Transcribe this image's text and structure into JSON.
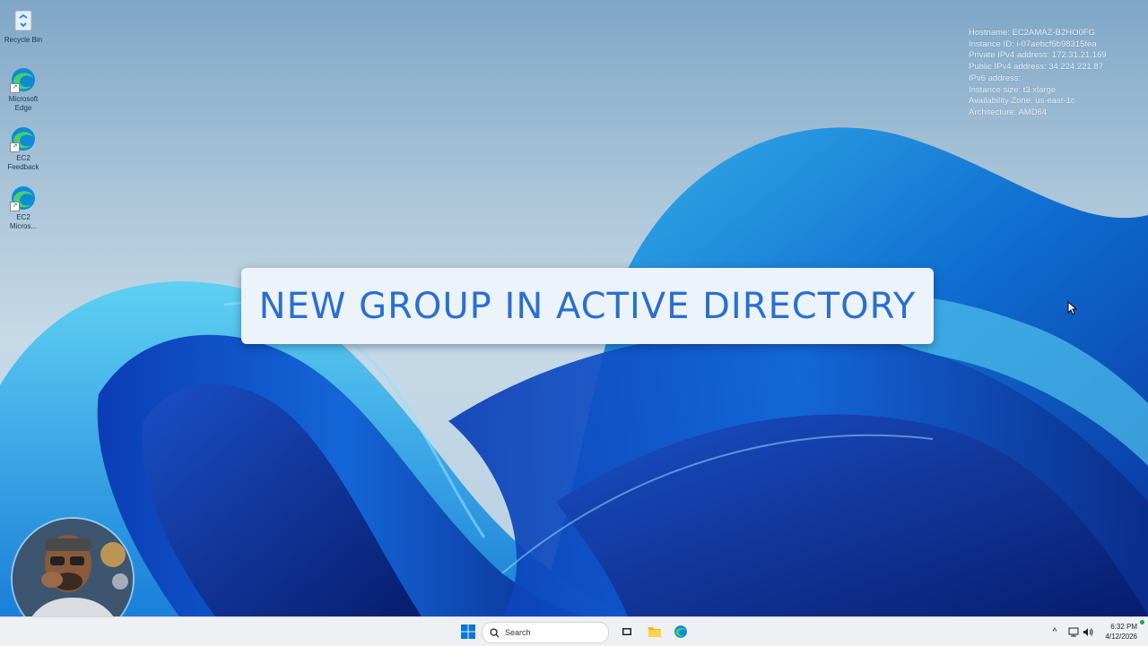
{
  "desktop": {
    "icons": [
      {
        "label": "Recycle Bin",
        "icon": "recycle-bin-icon"
      },
      {
        "label": "Microsoft Edge",
        "icon": "edge-icon"
      },
      {
        "label": "EC2 Feedback",
        "icon": "edge-icon"
      },
      {
        "label": "EC2 Micros...",
        "icon": "edge-icon"
      }
    ]
  },
  "sysinfo": {
    "hostname": "Hostname: EC2AMAZ-B2HO0FG",
    "instance_id": "Instance ID: i-07aebcf6b98315fea",
    "private_ipv4": "Private IPv4 address: 172.31.21.169",
    "public_ipv4": "Public IPv4 address: 34.224.221.87",
    "ipv6": "IPv6 address:",
    "instance_size": "Instance size: t3.xlarge",
    "availability_zone": "Availability Zone: us-east-1c",
    "architecture": "Architecture: AMD64"
  },
  "banner": {
    "title": "NEW GROUP IN ACTIVE DIRECTORY"
  },
  "taskbar": {
    "search_placeholder": "Search",
    "time": "6:32 PM",
    "date": "4/12/2026"
  },
  "colors": {
    "banner_text": "#2a6fd1",
    "banner_bg": "#edf3fb",
    "taskbar_bg": "#eef0f3",
    "windows_blue": "#0a78d4"
  }
}
